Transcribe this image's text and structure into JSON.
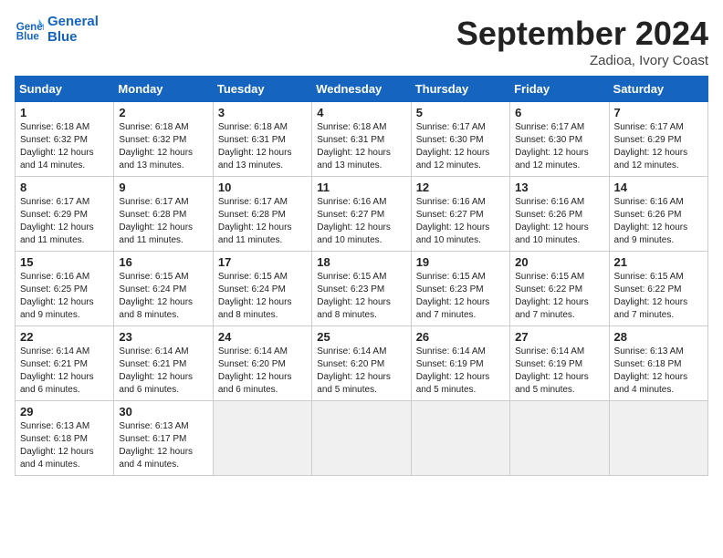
{
  "header": {
    "logo_line1": "General",
    "logo_line2": "Blue",
    "month": "September 2024",
    "location": "Zadioa, Ivory Coast"
  },
  "days_of_week": [
    "Sunday",
    "Monday",
    "Tuesday",
    "Wednesday",
    "Thursday",
    "Friday",
    "Saturday"
  ],
  "weeks": [
    [
      {
        "day": "1",
        "sunrise": "6:18 AM",
        "sunset": "6:32 PM",
        "daylight": "12 hours and 14 minutes."
      },
      {
        "day": "2",
        "sunrise": "6:18 AM",
        "sunset": "6:32 PM",
        "daylight": "12 hours and 13 minutes."
      },
      {
        "day": "3",
        "sunrise": "6:18 AM",
        "sunset": "6:31 PM",
        "daylight": "12 hours and 13 minutes."
      },
      {
        "day": "4",
        "sunrise": "6:18 AM",
        "sunset": "6:31 PM",
        "daylight": "12 hours and 13 minutes."
      },
      {
        "day": "5",
        "sunrise": "6:17 AM",
        "sunset": "6:30 PM",
        "daylight": "12 hours and 12 minutes."
      },
      {
        "day": "6",
        "sunrise": "6:17 AM",
        "sunset": "6:30 PM",
        "daylight": "12 hours and 12 minutes."
      },
      {
        "day": "7",
        "sunrise": "6:17 AM",
        "sunset": "6:29 PM",
        "daylight": "12 hours and 12 minutes."
      }
    ],
    [
      {
        "day": "8",
        "sunrise": "6:17 AM",
        "sunset": "6:29 PM",
        "daylight": "12 hours and 11 minutes."
      },
      {
        "day": "9",
        "sunrise": "6:17 AM",
        "sunset": "6:28 PM",
        "daylight": "12 hours and 11 minutes."
      },
      {
        "day": "10",
        "sunrise": "6:17 AM",
        "sunset": "6:28 PM",
        "daylight": "12 hours and 11 minutes."
      },
      {
        "day": "11",
        "sunrise": "6:16 AM",
        "sunset": "6:27 PM",
        "daylight": "12 hours and 10 minutes."
      },
      {
        "day": "12",
        "sunrise": "6:16 AM",
        "sunset": "6:27 PM",
        "daylight": "12 hours and 10 minutes."
      },
      {
        "day": "13",
        "sunrise": "6:16 AM",
        "sunset": "6:26 PM",
        "daylight": "12 hours and 10 minutes."
      },
      {
        "day": "14",
        "sunrise": "6:16 AM",
        "sunset": "6:26 PM",
        "daylight": "12 hours and 9 minutes."
      }
    ],
    [
      {
        "day": "15",
        "sunrise": "6:16 AM",
        "sunset": "6:25 PM",
        "daylight": "12 hours and 9 minutes."
      },
      {
        "day": "16",
        "sunrise": "6:15 AM",
        "sunset": "6:24 PM",
        "daylight": "12 hours and 8 minutes."
      },
      {
        "day": "17",
        "sunrise": "6:15 AM",
        "sunset": "6:24 PM",
        "daylight": "12 hours and 8 minutes."
      },
      {
        "day": "18",
        "sunrise": "6:15 AM",
        "sunset": "6:23 PM",
        "daylight": "12 hours and 8 minutes."
      },
      {
        "day": "19",
        "sunrise": "6:15 AM",
        "sunset": "6:23 PM",
        "daylight": "12 hours and 7 minutes."
      },
      {
        "day": "20",
        "sunrise": "6:15 AM",
        "sunset": "6:22 PM",
        "daylight": "12 hours and 7 minutes."
      },
      {
        "day": "21",
        "sunrise": "6:15 AM",
        "sunset": "6:22 PM",
        "daylight": "12 hours and 7 minutes."
      }
    ],
    [
      {
        "day": "22",
        "sunrise": "6:14 AM",
        "sunset": "6:21 PM",
        "daylight": "12 hours and 6 minutes."
      },
      {
        "day": "23",
        "sunrise": "6:14 AM",
        "sunset": "6:21 PM",
        "daylight": "12 hours and 6 minutes."
      },
      {
        "day": "24",
        "sunrise": "6:14 AM",
        "sunset": "6:20 PM",
        "daylight": "12 hours and 6 minutes."
      },
      {
        "day": "25",
        "sunrise": "6:14 AM",
        "sunset": "6:20 PM",
        "daylight": "12 hours and 5 minutes."
      },
      {
        "day": "26",
        "sunrise": "6:14 AM",
        "sunset": "6:19 PM",
        "daylight": "12 hours and 5 minutes."
      },
      {
        "day": "27",
        "sunrise": "6:14 AM",
        "sunset": "6:19 PM",
        "daylight": "12 hours and 5 minutes."
      },
      {
        "day": "28",
        "sunrise": "6:13 AM",
        "sunset": "6:18 PM",
        "daylight": "12 hours and 4 minutes."
      }
    ],
    [
      {
        "day": "29",
        "sunrise": "6:13 AM",
        "sunset": "6:18 PM",
        "daylight": "12 hours and 4 minutes."
      },
      {
        "day": "30",
        "sunrise": "6:13 AM",
        "sunset": "6:17 PM",
        "daylight": "12 hours and 4 minutes."
      },
      null,
      null,
      null,
      null,
      null
    ]
  ]
}
